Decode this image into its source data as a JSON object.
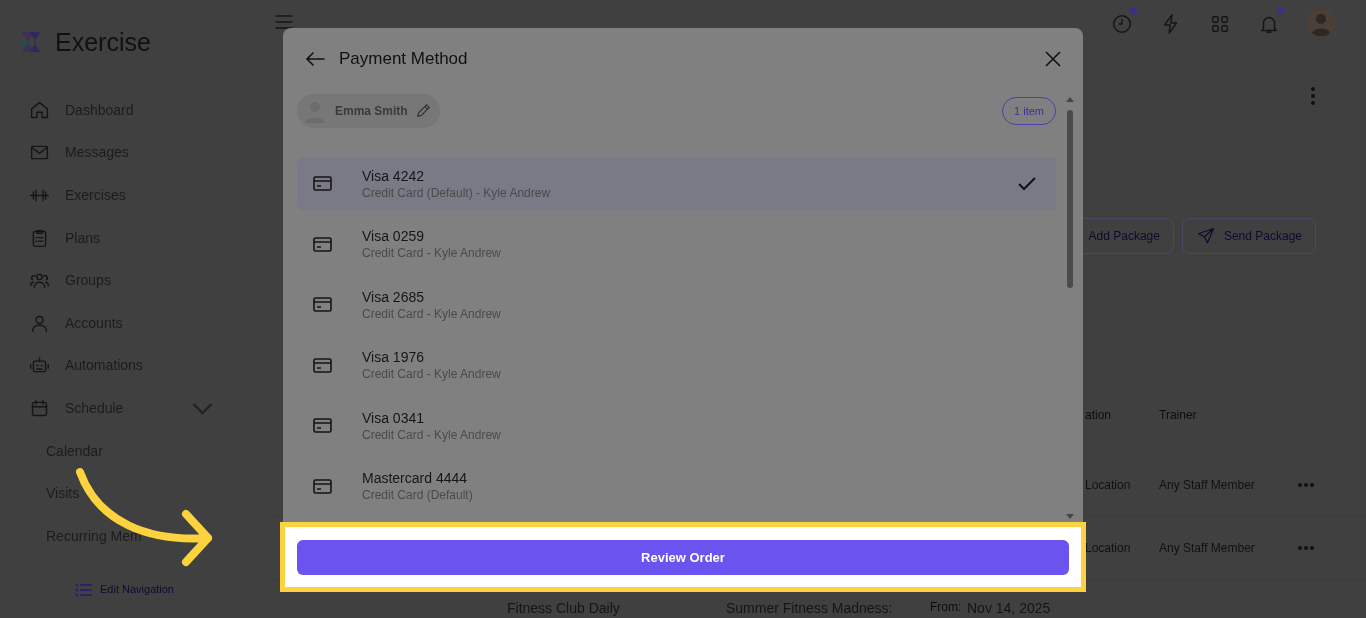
{
  "sidebar": {
    "logo_text": "Exercise",
    "items": [
      {
        "label": "Dashboard"
      },
      {
        "label": "Messages"
      },
      {
        "label": "Exercises"
      },
      {
        "label": "Plans"
      },
      {
        "label": "Groups"
      },
      {
        "label": "Accounts"
      },
      {
        "label": "Automations"
      },
      {
        "label": "Schedule",
        "expanded": true,
        "children": [
          {
            "label": "Calendar"
          },
          {
            "label": "Visits"
          },
          {
            "label": "Recurring Mem"
          }
        ]
      }
    ],
    "edit_navigation": "Edit Navigation"
  },
  "header": {
    "icons": [
      {
        "dot": true
      },
      {
        "dot": false
      },
      {
        "dot": false
      },
      {
        "dot": true
      }
    ]
  },
  "page": {
    "buttons": [
      "Add Package",
      "Send Package"
    ],
    "table": {
      "columns": [
        {
          "label": "ation"
        },
        {
          "label": "Trainer"
        }
      ],
      "rows": [
        {
          "cells": [
            "Location",
            "Any Staff Member"
          ]
        },
        {
          "cells": [
            "Location",
            "Any Staff Member"
          ]
        }
      ]
    },
    "bottom_row": [
      "Fitness Club Daily",
      "Summer Fitness Madness:",
      "From:",
      "Nov 14, 2025"
    ]
  },
  "modal": {
    "title": "Payment Method",
    "customer": "Emma Smith",
    "count": "1 item",
    "methods": [
      {
        "title": "Visa 4242",
        "detail": "Credit Card (Default) - Kyle Andrew",
        "selected": true
      },
      {
        "title": "Visa 0259",
        "detail": "Credit Card - Kyle Andrew",
        "selected": false
      },
      {
        "title": "Visa 2685",
        "detail": "Credit Card - Kyle Andrew",
        "selected": false
      },
      {
        "title": "Visa 1976",
        "detail": "Credit Card - Kyle Andrew",
        "selected": false
      },
      {
        "title": "Visa 0341",
        "detail": "Credit Card - Kyle Andrew",
        "selected": false
      },
      {
        "title": "Mastercard 4444",
        "detail": "Credit Card (Default)",
        "selected": false
      }
    ],
    "primary_button": "Review Order"
  }
}
